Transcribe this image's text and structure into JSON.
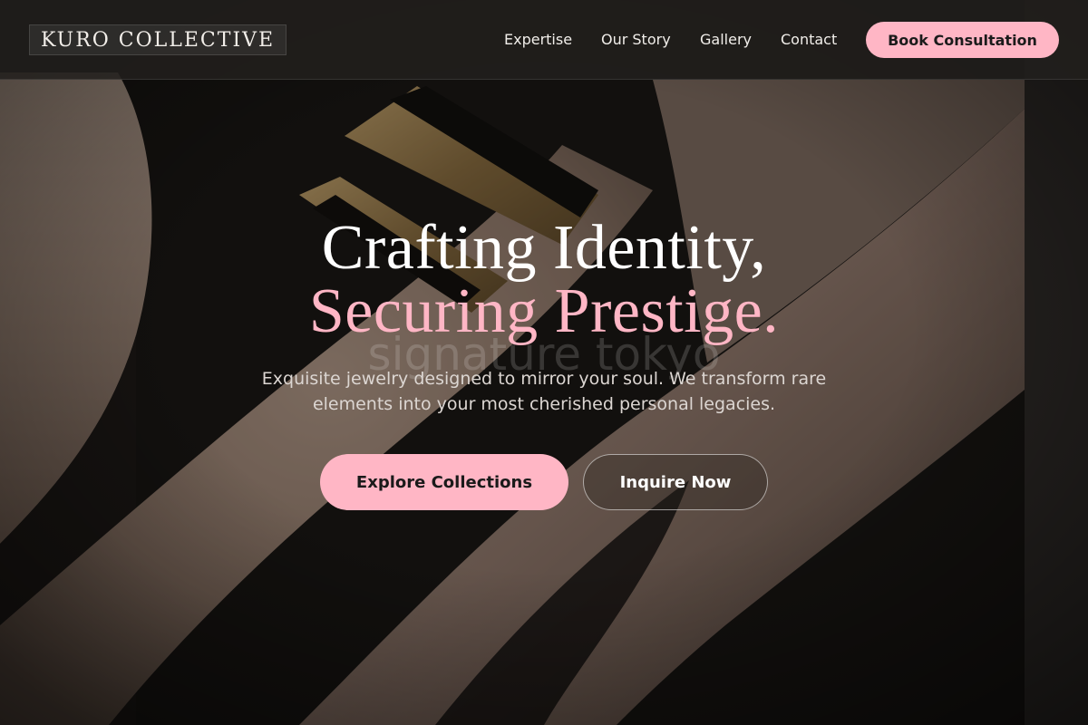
{
  "header": {
    "logo_text": "KURO COLLECTIVE",
    "nav": {
      "expertise": "Expertise",
      "our_story": "Our Story",
      "gallery": "Gallery",
      "contact": "Contact"
    },
    "cta_label": "Book Consultation"
  },
  "hero": {
    "title_line1": "Crafting Identity,",
    "title_line2": "Securing Prestige.",
    "watermark": "signature tokyo",
    "subtitle": "Exquisite jewelry designed to mirror your soul. We transform rare elements into your most cherished personal legacies.",
    "primary_button": "Explore Collections",
    "secondary_button": "Inquire Now"
  },
  "colors": {
    "accent": "#ffb6c5",
    "header_bg": "#221f1d",
    "text_light": "#ffffff"
  }
}
